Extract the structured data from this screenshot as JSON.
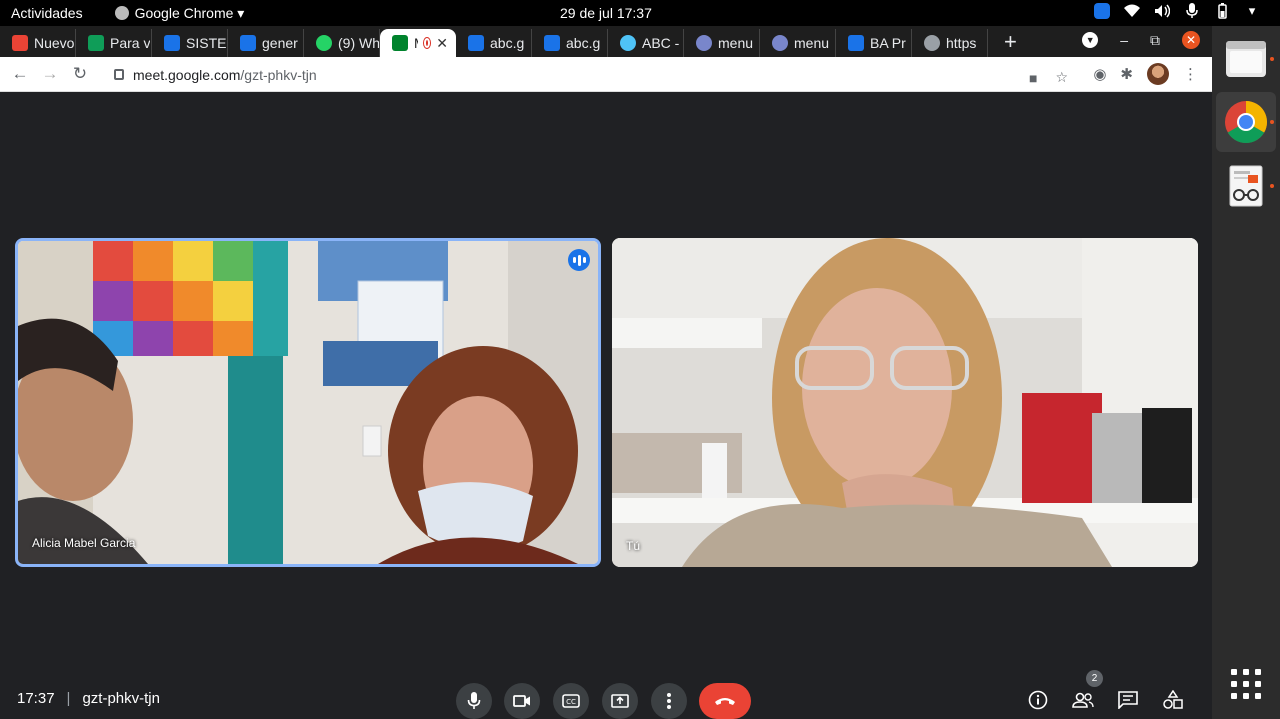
{
  "topbar": {
    "activities": "Actividades",
    "app_name": "Google Chrome ▾",
    "clock": "29 de jul  17:37"
  },
  "tabs": [
    {
      "label": "Nuevo",
      "color": "#ea4335"
    },
    {
      "label": "Para v",
      "color": "#0f9d58"
    },
    {
      "label": "SISTEM",
      "color": "#1a73e8"
    },
    {
      "label": "gener",
      "color": "#1a73e8"
    },
    {
      "label": "(9) Wh",
      "color": "#25d366"
    },
    {
      "label": "M",
      "color": "#00832d"
    },
    {
      "label": "abc.g",
      "color": "#1a73e8"
    },
    {
      "label": "abc.g",
      "color": "#1a73e8"
    },
    {
      "label": "ABC -",
      "color": "#4fc3f7"
    },
    {
      "label": "menu",
      "color": "#7986cb"
    },
    {
      "label": "menu",
      "color": "#7986cb"
    },
    {
      "label": "BA Pr",
      "color": "#1a73e8"
    },
    {
      "label": "https",
      "color": "#9aa0a6"
    }
  ],
  "toolbar": {
    "url_host": "meet.google.com",
    "url_path": "/gzt-phkv-tjn"
  },
  "participants": [
    {
      "name": "Alicia Mabel Garcia"
    },
    {
      "name": "Tú"
    }
  ],
  "meeting": {
    "time": "17:37",
    "separator": "|",
    "code": "gzt-phkv-tjn",
    "people_count": "2"
  },
  "colors": {
    "accent": "#8ab4f8",
    "end_call": "#ea4335",
    "background": "#202124"
  }
}
